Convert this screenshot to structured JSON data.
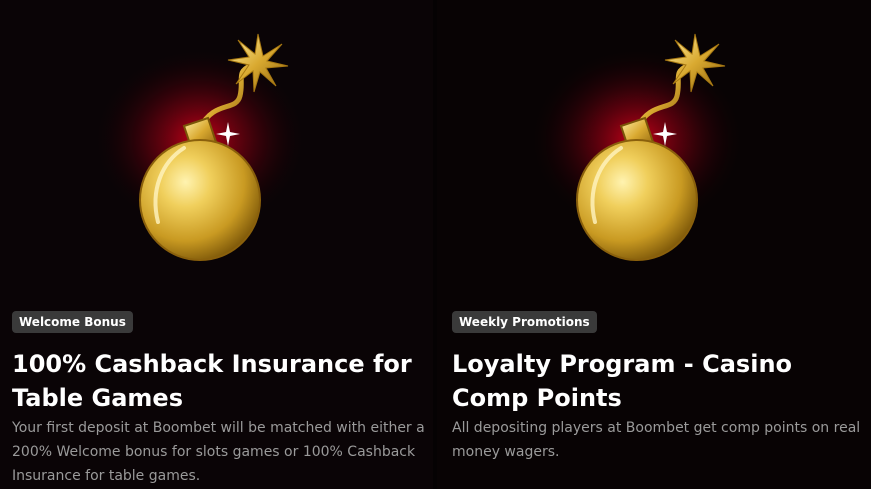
{
  "promotions": [
    {
      "badge": "Welcome Bonus",
      "title": "100% Cashback Insurance for Table Games",
      "description": "Your first deposit at Boombet will be matched with either a 200% Welcome bonus for slots games or 100% Cashback Insurance for table games.",
      "image_icon": "golden-bomb-icon"
    },
    {
      "badge": "Weekly Promotions",
      "title": "Loyalty Program - Casino Comp Points",
      "description": "All depositing players at Boombet get comp points on real money wagers.",
      "image_icon": "golden-bomb-icon"
    }
  ],
  "colors": {
    "background": "#050203",
    "badge_bg": "#3a3a3a",
    "title": "#ffffff",
    "description": "#9a9a9a",
    "gold": "#e8c24a",
    "glow": "#b00010"
  }
}
